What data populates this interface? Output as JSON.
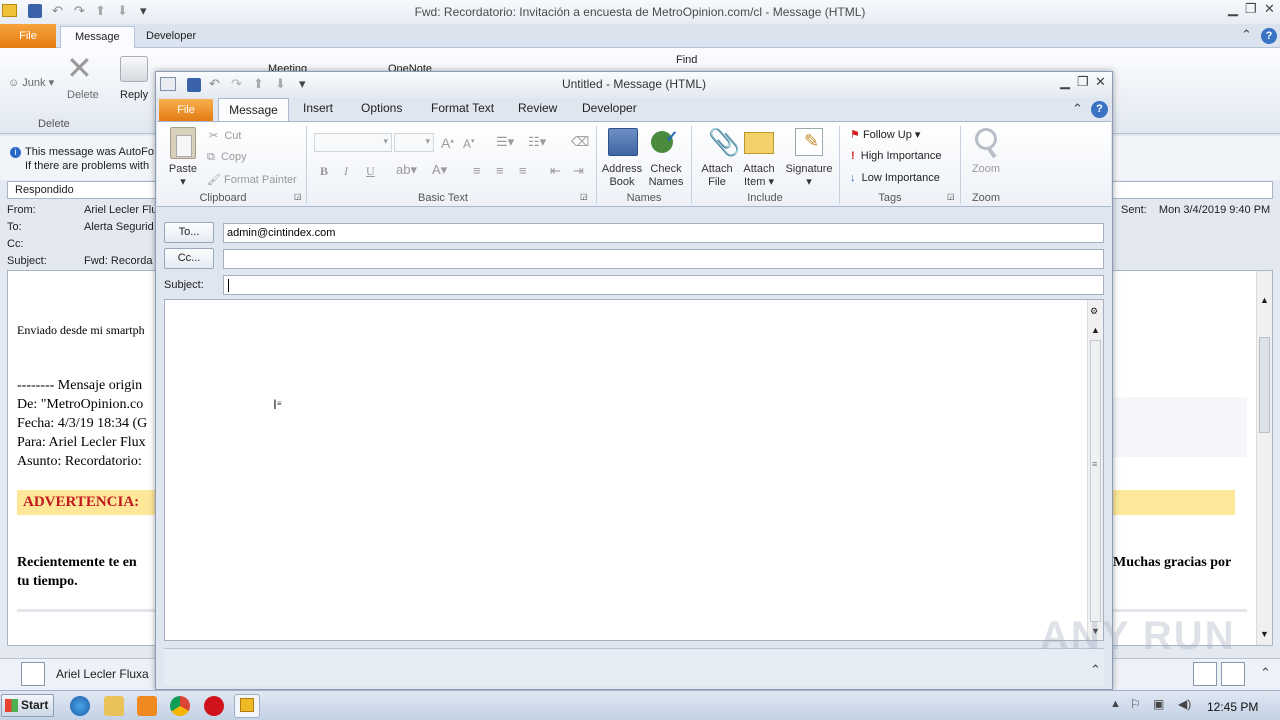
{
  "bg_window": {
    "title": "Fwd: Recordatorio: Invitación a encuesta de MetroOpinion.com/cl  -  Message (HTML)",
    "tabs": {
      "file": "File",
      "message": "Message",
      "developer": "Developer"
    },
    "ribbon": {
      "junk": "Junk",
      "delete": "Delete",
      "reply": "Reply",
      "meeting": "Meeting",
      "onenote": "OneNote",
      "find": "Find",
      "group_delete": "Delete"
    },
    "info": {
      "autoforward": "This message was AutoFo",
      "problems": "If there are problems with"
    },
    "status": "Respondido",
    "headers": {
      "from_label": "From:",
      "from_value": "Ariel Lecler Flux",
      "to_label": "To:",
      "to_value": "Alerta Segurid",
      "cc_label": "Cc:",
      "subject_label": "Subject:",
      "subject_value": "Fwd: Recorda",
      "sent_label": "Sent:",
      "sent_value": "Mon 3/4/2019 9:40 PM"
    },
    "body": {
      "line1": "Enviado desde mi smartph",
      "line2": "-------- Mensaje origin",
      "line3": "De: \"MetroOpinion.co",
      "line4": "Fecha: 4/3/19 18:34 (G",
      "line5": "Para: Ariel Lecler Flux",
      "line6": "Asunto: Recordatorio:",
      "warning": "ADVERTENCIA:",
      "para_start": "Recientemente te en",
      "para_end": "Muchas gracias por",
      "para_line2": "tu tiempo."
    },
    "people_pane_name": "Ariel Lecler Fluxa"
  },
  "compose": {
    "title": "Untitled  -  Message (HTML)",
    "tabs": {
      "file": "File",
      "message": "Message",
      "insert": "Insert",
      "options": "Options",
      "format_text": "Format Text",
      "review": "Review",
      "developer": "Developer"
    },
    "clipboard": {
      "paste": "Paste",
      "cut": "Cut",
      "copy": "Copy",
      "format_painter": "Format Painter",
      "label": "Clipboard"
    },
    "basic_text": {
      "label": "Basic Text",
      "bold": "B",
      "italic": "I",
      "underline": "U"
    },
    "names": {
      "address_book_1": "Address",
      "address_book_2": "Book",
      "check_names_1": "Check",
      "check_names_2": "Names",
      "label": "Names"
    },
    "include": {
      "attach_file_1": "Attach",
      "attach_file_2": "File",
      "attach_item_1": "Attach",
      "attach_item_2": "Item",
      "signature": "Signature",
      "label": "Include"
    },
    "tags": {
      "follow_up": "Follow Up",
      "high_importance": "High Importance",
      "low_importance": "Low Importance",
      "label": "Tags"
    },
    "zoom": {
      "zoom": "Zoom",
      "label": "Zoom"
    },
    "fields": {
      "to_button": "To...",
      "to_value": "admin@cintindex.com",
      "cc_button": "Cc...",
      "cc_value": "",
      "subject_label": "Subject:",
      "subject_value": ""
    }
  },
  "taskbar": {
    "start": "Start",
    "clock": "12:45 PM"
  },
  "watermark": "ANY RUN",
  "colors": {
    "file_tab_orange": "#e47b11",
    "warning_red": "#c0181e",
    "warning_bg": "#ffe79a",
    "ribbon_blue": "#dfe6f0"
  }
}
